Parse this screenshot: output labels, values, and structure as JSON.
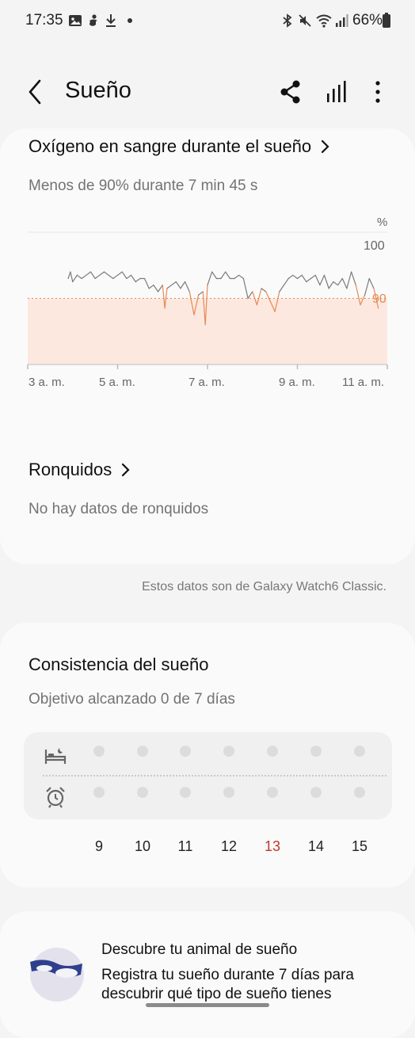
{
  "status_bar": {
    "time": "17:35",
    "battery": "66%",
    "left_icons": [
      "image-icon",
      "accessibility-icon",
      "download-icon",
      "dot-icon"
    ],
    "right_icons": [
      "bluetooth-icon",
      "mute-icon",
      "wifi-icon",
      "signal-icon",
      "battery-icon"
    ]
  },
  "header": {
    "title": "Sueño",
    "actions": [
      "share-icon",
      "stats-icon",
      "more-icon"
    ]
  },
  "oxygen": {
    "title": "Oxígeno en sangre durante el sueño",
    "subtitle": "Menos de 90% durante 7 min 45 s"
  },
  "chart_data": {
    "type": "line",
    "title": "",
    "unit_label": "%",
    "ylim": [
      80,
      100
    ],
    "threshold": 90,
    "y_ticks": [
      {
        "value": 100,
        "label": "100"
      },
      {
        "value": 90,
        "label": "90"
      }
    ],
    "x_ticks": [
      "3 a. m.",
      "5 a. m.",
      "7 a. m.",
      "9 a. m.",
      "11 a. m."
    ],
    "x_range_hours": [
      3,
      11
    ],
    "series": [
      {
        "x": [
          3.9,
          3.95,
          4.0,
          4.1,
          4.2,
          4.3,
          4.4,
          4.5,
          4.6,
          4.7,
          4.8,
          4.9,
          5.0,
          5.1,
          5.2,
          5.3,
          5.4,
          5.5,
          5.6,
          5.7,
          5.8,
          5.9,
          6.0,
          6.05,
          6.1,
          6.2,
          6.3,
          6.4,
          6.5,
          6.6,
          6.7,
          6.8,
          6.9,
          6.95,
          7.0,
          7.1,
          7.2,
          7.3,
          7.4,
          7.5,
          7.6,
          7.7,
          7.8,
          7.9,
          8.0,
          8.1,
          8.2,
          8.3,
          8.4,
          8.5,
          8.6,
          8.7,
          8.8,
          8.9,
          9.0,
          9.1,
          9.2,
          9.3,
          9.4,
          9.5,
          9.6,
          9.7,
          9.8,
          9.9,
          10.0,
          10.1,
          10.2,
          10.3,
          10.4,
          10.5,
          10.6,
          10.7,
          10.8
        ],
        "values": [
          93,
          94,
          92.5,
          93.5,
          93,
          93.5,
          94,
          93,
          93.5,
          94,
          93.5,
          93,
          93.5,
          94,
          93,
          93.5,
          92.5,
          93,
          93,
          91.5,
          92,
          91,
          92,
          88.5,
          91.5,
          92,
          92.5,
          91.5,
          92.5,
          91,
          87.5,
          90.5,
          91,
          86,
          92,
          94,
          93,
          93,
          94,
          93,
          93,
          93.5,
          93,
          90,
          91,
          89,
          91.5,
          91,
          89.5,
          88,
          91,
          92,
          93,
          93.5,
          93,
          93.5,
          92.5,
          93,
          93.5,
          92,
          93.5,
          91.5,
          92.5,
          92,
          93,
          91.5,
          94,
          92,
          89,
          90.5,
          93,
          91.5,
          88.5
        ]
      }
    ]
  },
  "snoring": {
    "title": "Ronquidos",
    "subtitle": "No hay datos de ronquidos"
  },
  "source_note": "Estos datos son de Galaxy Watch6 Classic.",
  "consistency": {
    "title": "Consistencia del sueño",
    "subtitle": "Objetivo alcanzado 0 de 7 días",
    "rows": [
      "bed-icon",
      "alarm-clock-icon"
    ],
    "days": [
      "9",
      "10",
      "11",
      "12",
      "13",
      "14",
      "15"
    ],
    "today": "13",
    "today_color": "#c0392b"
  },
  "animal": {
    "title": "Descubre tu animal de sueño",
    "description": "Registra tu sueño durante 7 días para descubrir qué tipo de sueño tienes"
  },
  "colors": {
    "accent_orange": "#e58a55",
    "band_fill": "#fde8df",
    "line_gray": "#7a7a7a"
  }
}
